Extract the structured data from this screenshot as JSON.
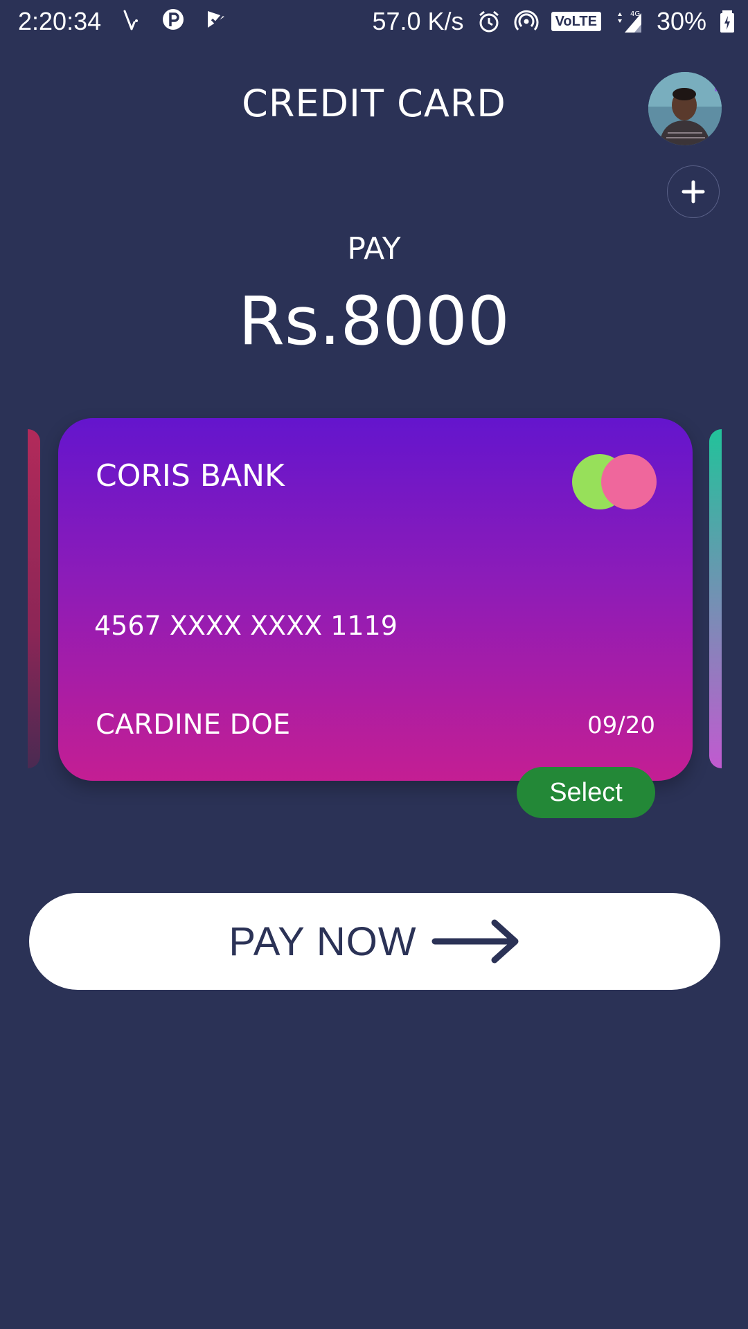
{
  "status_bar": {
    "time": "2:20:34",
    "network_speed": "57.0 K/s",
    "volte": "VoLTE",
    "network_type": "4G",
    "battery": "30%"
  },
  "header": {
    "title": "CREDIT CARD"
  },
  "payment": {
    "label": "PAY",
    "amount": "Rs.8000"
  },
  "card": {
    "bank_name": "CORIS BANK",
    "number": "4567 XXXX XXXX 1119",
    "holder": "CARDINE DOE",
    "expiry": "09/20",
    "gradient_top": "#6415cd",
    "gradient_bottom": "#c41e93",
    "logo_left_color": "#97e05a",
    "logo_right_color": "#ef679c"
  },
  "actions": {
    "select_label": "Select",
    "add_icon": "plus-icon",
    "pay_now_label": "PAY NOW",
    "pay_now_icon": "arrow-right-icon"
  },
  "colors": {
    "background": "#2b3256",
    "select_green": "#238837",
    "button_white": "#ffffff"
  }
}
